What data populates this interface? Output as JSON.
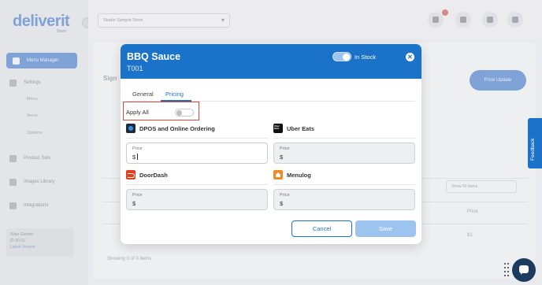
{
  "app": {
    "logo_text": "deliverit",
    "logo_sub": "Store",
    "business_select": "Studio Sample Store",
    "nav_active": "Menu Manager",
    "nav_items": [
      "Settings",
      "Product Sets",
      "Images Library",
      "Integrations"
    ],
    "settings_sub": [
      "Menu",
      "Items",
      "Options"
    ],
    "user_name": "Wise Garden",
    "user_id": "ID 00 01",
    "user_link": "Latest Version",
    "page_heading": "Sign",
    "primary_button": "Price Update",
    "table_header": "Price",
    "table_select": "Show 50 Items",
    "row_value": "$1",
    "footer_text": "Showing 0 of 0 Items",
    "feedback_label": "Feedback"
  },
  "modal": {
    "title": "BBQ Sauce",
    "code": "T001",
    "stock_label": "In Stock",
    "stock_on": true,
    "tabs": [
      {
        "label": "General",
        "active": false
      },
      {
        "label": "Pricing",
        "active": true
      }
    ],
    "apply_all_label": "Apply All",
    "apply_all_on": false,
    "channels": [
      {
        "name": "DPOS and Online Ordering",
        "icon": "dpos-logo-icon",
        "price_label": "Price",
        "price_value": "$",
        "editable": true
      },
      {
        "name": "Uber Eats",
        "icon": "uber-eats-logo-icon",
        "price_label": "Price",
        "price_value": "$",
        "editable": false
      },
      {
        "name": "DoorDash",
        "icon": "doordash-logo-icon",
        "price_label": "Price",
        "price_value": "$",
        "editable": false
      },
      {
        "name": "Menulog",
        "icon": "menulog-logo-icon",
        "price_label": "Price",
        "price_value": "$",
        "editable": false
      }
    ],
    "cancel_label": "Cancel",
    "save_label": "Save"
  },
  "colors": {
    "primary": "#1a73c8",
    "highlight_border": "#d94a3d",
    "save_disabled": "#9cc4ee"
  }
}
